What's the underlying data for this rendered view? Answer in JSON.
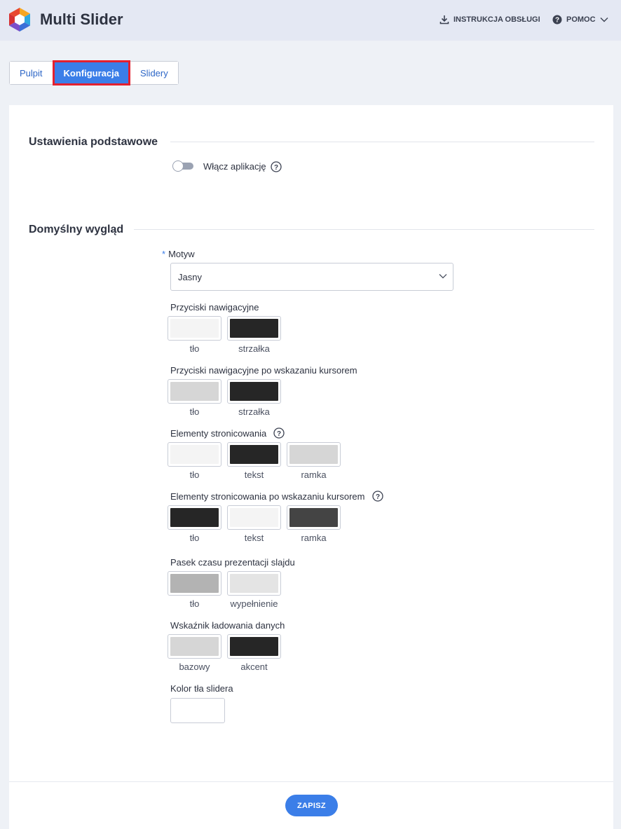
{
  "app": {
    "title": "Multi Slider"
  },
  "header": {
    "manual_label": "INSTRUKCJA OBSŁUGI",
    "help_label": "POMOC"
  },
  "tabs": [
    {
      "label": "Pulpit",
      "active": false
    },
    {
      "label": "Konfiguracja",
      "active": true
    },
    {
      "label": "Slidery",
      "active": false
    }
  ],
  "basic": {
    "title": "Ustawienia podstawowe",
    "enable_label": "Włącz aplikację",
    "enabled": false
  },
  "look": {
    "title": "Domyślny wygląd",
    "theme_label": "Motyw",
    "theme_required_mark": "*",
    "theme_value": "Jasny",
    "groups": [
      {
        "label": "Przyciski nawigacyjne",
        "help": false,
        "swatches": [
          {
            "caption": "tło",
            "color": "#f4f4f4"
          },
          {
            "caption": "strzałka",
            "color": "#262626"
          }
        ]
      },
      {
        "label": "Przyciski nawigacyjne po wskazaniu kursorem",
        "help": false,
        "swatches": [
          {
            "caption": "tło",
            "color": "#d6d6d6"
          },
          {
            "caption": "strzałka",
            "color": "#262626"
          }
        ]
      },
      {
        "label": "Elementy stronicowania",
        "help": true,
        "swatches": [
          {
            "caption": "tło",
            "color": "#f4f4f4"
          },
          {
            "caption": "tekst",
            "color": "#262626"
          },
          {
            "caption": "ramka",
            "color": "#d6d6d6"
          }
        ]
      },
      {
        "label": "Elementy stronicowania po wskazaniu kursorem",
        "help": true,
        "swatches": [
          {
            "caption": "tło",
            "color": "#262626"
          },
          {
            "caption": "tekst",
            "color": "#f4f4f4"
          },
          {
            "caption": "ramka",
            "color": "#444444"
          }
        ]
      },
      {
        "label": "Pasek czasu prezentacji slajdu",
        "help": false,
        "swatches": [
          {
            "caption": "tło",
            "color": "#b3b3b3"
          },
          {
            "caption": "wypełnienie",
            "color": "#e4e4e4"
          }
        ]
      },
      {
        "label": "Wskaźnik ładowania danych",
        "help": false,
        "swatches": [
          {
            "caption": "bazowy",
            "color": "#d6d6d6"
          },
          {
            "caption": "akcent",
            "color": "#262626"
          }
        ]
      }
    ],
    "bg_label": "Kolor tła slidera",
    "bg_color": "#ffffff"
  },
  "footer": {
    "save_label": "ZAPISZ"
  },
  "colors": {
    "accent": "#3b7ee8",
    "highlight": "#e3202f"
  }
}
